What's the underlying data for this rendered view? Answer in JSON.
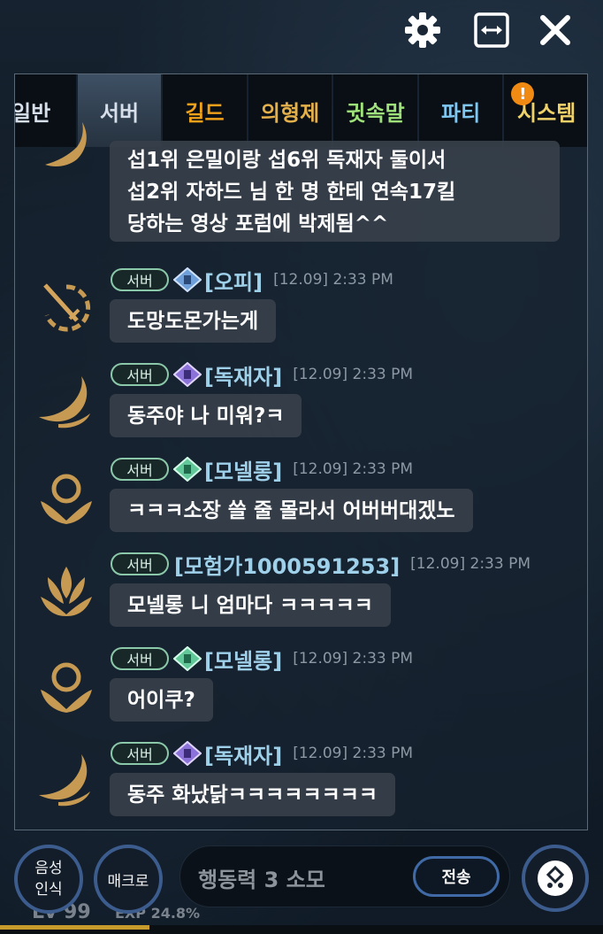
{
  "window": {
    "settings_icon": "gear-icon",
    "resize_icon": "horizontal-expand-icon",
    "close_icon": "close-icon"
  },
  "tabs": [
    {
      "label": "일반",
      "color": "#d7e0ea",
      "active": false
    },
    {
      "label": "서버",
      "color": "#d7e0ea",
      "active": true
    },
    {
      "label": "길드",
      "color": "#f0a11a",
      "active": false
    },
    {
      "label": "의형제",
      "color": "#e3b04b",
      "active": false
    },
    {
      "label": "귓속말",
      "color": "#9ee07a",
      "active": false
    },
    {
      "label": "파티",
      "color": "#7fc6f0",
      "active": false
    },
    {
      "label": "시스템",
      "color": "#f0d26a",
      "active": false,
      "badge": "!"
    }
  ],
  "messages": [
    {
      "partial": true,
      "lines": [
        "섭1위 은밀이랑 섭6위 독재자 둘이서",
        "섭2위 자하드 님 한 명 한테 연속17킬",
        "당하는 영상 포럼에 박제됨^^"
      ]
    },
    {
      "channel": "서버",
      "user": "[오피]",
      "time": "[12.09] 2:33 PM",
      "text": "도망도몬가는게",
      "rank_icon": "blue-rank-icon",
      "avatar": "sword-emblem-icon"
    },
    {
      "channel": "서버",
      "user": "[독재자]",
      "time": "[12.09] 2:33 PM",
      "text": "동주야 나 미워?ㅋ",
      "rank_icon": "purple-rank-icon",
      "avatar": "flame-wing-emblem-icon"
    },
    {
      "channel": "서버",
      "user": "[모넬롱]",
      "time": "[12.09] 2:33 PM",
      "text": "ㅋㅋㅋ소장 쓸 줄 몰라서 어버버대겠노",
      "rank_icon": "green-rank-icon",
      "avatar": "lotus-orb-emblem-icon"
    },
    {
      "channel": "서버",
      "user": "[모험가1000591253]",
      "time": "[12.09] 2:33 PM",
      "text": "모넬롱 니 엄마다 ㅋㅋㅋㅋㅋ",
      "rank_icon": "",
      "avatar": "lotus-flame-emblem-icon"
    },
    {
      "channel": "서버",
      "user": "[모넬롱]",
      "time": "[12.09] 2:33 PM",
      "text": "어이쿠?",
      "rank_icon": "green-rank-icon",
      "avatar": "lotus-orb-emblem-icon"
    },
    {
      "channel": "서버",
      "user": "[독재자]",
      "time": "[12.09] 2:33 PM",
      "text": "동주 화났닭ㅋㅋㅋㅋㅋㅋㅋㅋ",
      "rank_icon": "purple-rank-icon",
      "avatar": "flame-wing-emblem-icon"
    }
  ],
  "bottom": {
    "voice_label_1": "음성",
    "voice_label_2": "인식",
    "macro_label": "매크로",
    "input_placeholder": "행동력 3 소모",
    "send_label": "전송",
    "emote_icon": "emoticon-icon",
    "level_text": "Lv 99",
    "exp_text": "EXP 24.8%",
    "exp_fraction": 0.248
  }
}
